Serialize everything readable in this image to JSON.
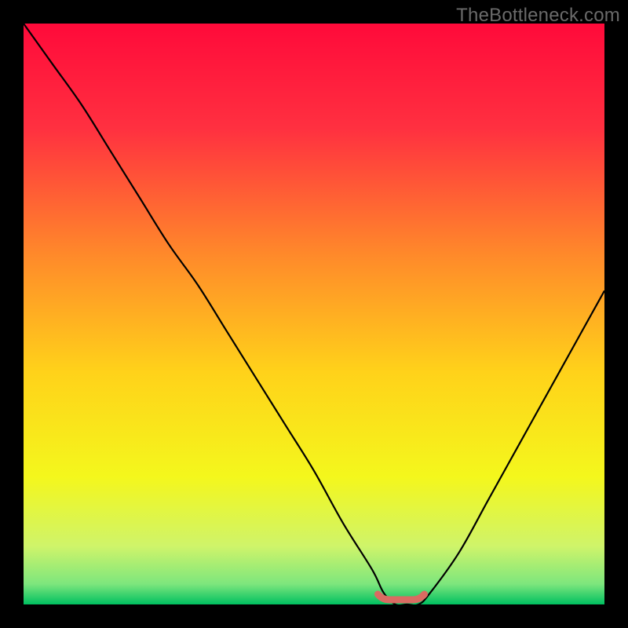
{
  "watermark": "TheBottleneck.com",
  "chart_data": {
    "type": "line",
    "title": "",
    "xlabel": "",
    "ylabel": "",
    "xlim": [
      0,
      100
    ],
    "ylim": [
      0,
      100
    ],
    "series": [
      {
        "name": "bottleneck-curve",
        "x": [
          0,
          5,
          10,
          15,
          20,
          25,
          30,
          35,
          40,
          45,
          50,
          55,
          60,
          62,
          64,
          66,
          68,
          70,
          75,
          80,
          85,
          90,
          95,
          100
        ],
        "values": [
          100,
          93,
          86,
          78,
          70,
          62,
          55,
          47,
          39,
          31,
          23,
          14,
          6,
          2,
          0,
          0,
          0,
          2,
          9,
          18,
          27,
          36,
          45,
          54
        ]
      }
    ],
    "marker": {
      "name": "optimal-range",
      "x_start": 61,
      "x_end": 69,
      "y": 0,
      "color": "#d96b62"
    },
    "background_gradient": {
      "type": "vertical",
      "stops": [
        {
          "pos": 0.0,
          "color": "#ff0a3a"
        },
        {
          "pos": 0.18,
          "color": "#ff3040"
        },
        {
          "pos": 0.4,
          "color": "#ff8a2a"
        },
        {
          "pos": 0.6,
          "color": "#ffd21a"
        },
        {
          "pos": 0.78,
          "color": "#f4f71c"
        },
        {
          "pos": 0.9,
          "color": "#cff46a"
        },
        {
          "pos": 0.965,
          "color": "#7de67d"
        },
        {
          "pos": 1.0,
          "color": "#00c060"
        }
      ]
    }
  }
}
